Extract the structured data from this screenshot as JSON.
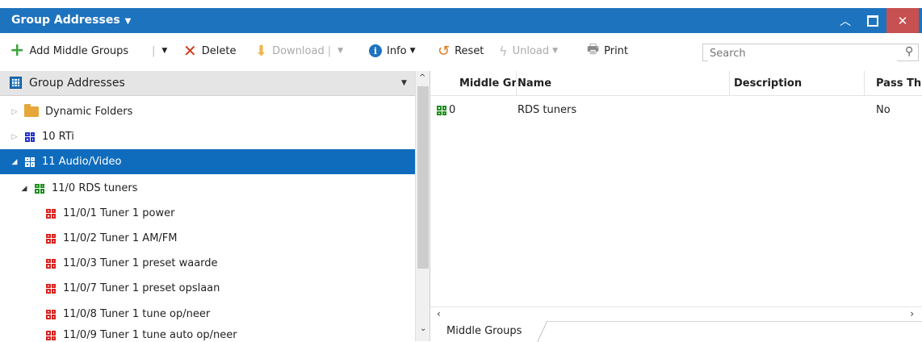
{
  "window": {
    "title": "Group Addresses"
  },
  "toolbar": {
    "add": "Add Middle Groups",
    "delete": "Delete",
    "download": "Download",
    "info": "Info",
    "reset": "Reset",
    "unload": "Unload",
    "print": "Print"
  },
  "search": {
    "placeholder": "Search"
  },
  "tree": {
    "header": "Group Addresses",
    "items": [
      {
        "label": "Dynamic Folders"
      },
      {
        "label": "10 RTi"
      },
      {
        "label": "11 Audio/Video"
      },
      {
        "label": "11/0 RDS tuners"
      },
      {
        "label": "11/0/1 Tuner 1 power"
      },
      {
        "label": "11/0/2 Tuner 1 AM/FM"
      },
      {
        "label": "11/0/3 Tuner 1 preset waarde"
      },
      {
        "label": "11/0/7 Tuner 1 preset opslaan"
      },
      {
        "label": "11/0/8 Tuner 1 tune op/neer"
      },
      {
        "label": "11/0/9 Tuner 1 tune auto op/neer"
      }
    ]
  },
  "grid": {
    "columns": [
      "Middle Gr",
      "Name",
      "Description",
      "Pass Thr"
    ],
    "rows": [
      {
        "middle": "0",
        "name": "RDS tuners",
        "description": "",
        "pass": "No"
      }
    ]
  },
  "tabs": {
    "middle_groups": "Middle Groups"
  },
  "colors": {
    "accent": "#1e73be",
    "selected_row": "#0f6cbd",
    "close_button": "#c75050"
  }
}
